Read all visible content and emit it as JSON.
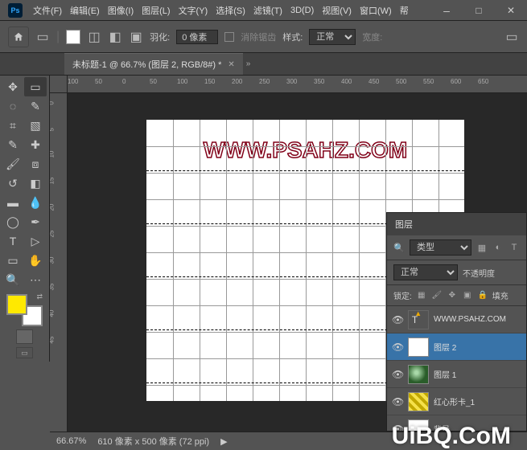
{
  "app_icon_text": "Ps",
  "menu": [
    "文件(F)",
    "编辑(E)",
    "图像(I)",
    "图层(L)",
    "文字(Y)",
    "选择(S)",
    "滤镜(T)",
    "3D(D)",
    "视图(V)",
    "窗口(W)",
    "帮"
  ],
  "options": {
    "feather_label": "羽化:",
    "feather_value": "0 像素",
    "antialias_label": "消除锯齿",
    "style_label": "样式:",
    "style_value": "正常",
    "width_label": "宽度:"
  },
  "tab": {
    "title": "未标题-1 @ 66.7% (图层 2, RGB/8#) *"
  },
  "rulers": {
    "h": [
      "100",
      "50",
      "0",
      "50",
      "100",
      "150",
      "200",
      "250",
      "300",
      "350",
      "400",
      "450",
      "500",
      "550",
      "600",
      "650"
    ],
    "v": [
      "0",
      "5",
      "10",
      "15",
      "20",
      "25",
      "30",
      "35",
      "40",
      "45"
    ]
  },
  "watermark_text": "WWW.PSAHZ.COM",
  "status": {
    "zoom": "66.67%",
    "docinfo": "610 像素 x 500 像素 (72 ppi)"
  },
  "layers_panel": {
    "title": "图层",
    "filter_label": "类型",
    "mode_value": "正常",
    "opacity_label": "不透明度",
    "lock_label": "锁定:",
    "fill_label": "填充",
    "items": [
      {
        "name": "WWW.PSAHZ.COM",
        "kind": "text"
      },
      {
        "name": "图层 2",
        "kind": "white"
      },
      {
        "name": "图层 1",
        "kind": "img1"
      },
      {
        "name": "红心形卡_1",
        "kind": "img2"
      },
      {
        "name": "背景",
        "kind": "white"
      }
    ]
  },
  "colors": {
    "fg": "#ffe900",
    "bg": "#ffffff"
  },
  "site_watermark": "UiBQ.CoM",
  "chart_data": null
}
